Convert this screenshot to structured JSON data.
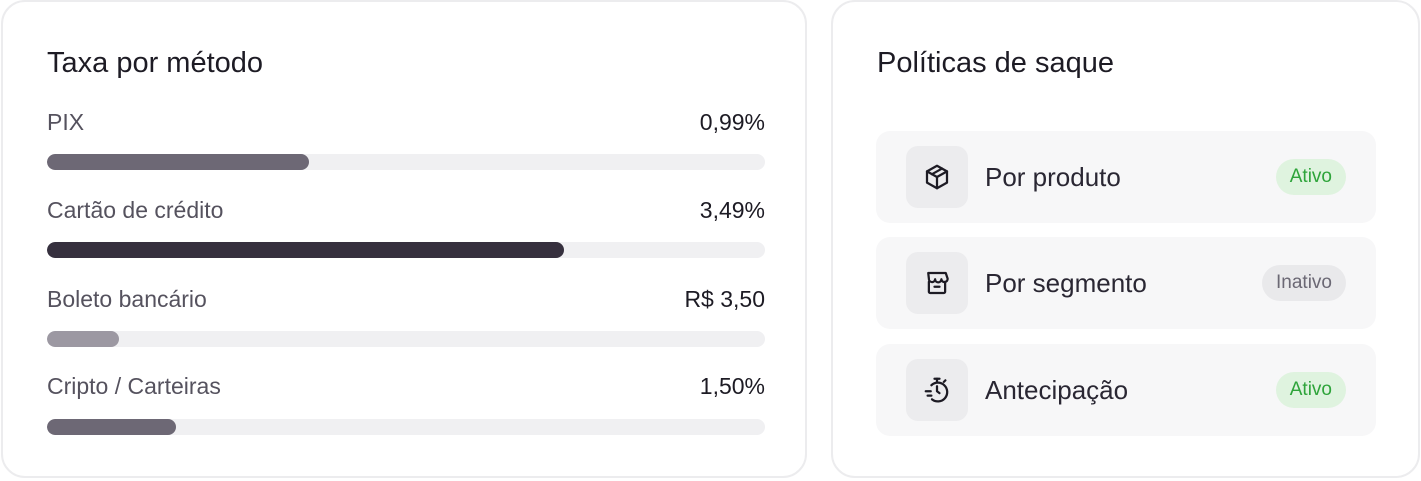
{
  "fees_card": {
    "title": "Taxa por método",
    "rows": [
      {
        "label": "PIX",
        "value": "0,99%",
        "level": 0.365,
        "color": "#6d6875"
      },
      {
        "label": "Cartão de crédito",
        "value": "3,49%",
        "level": 0.72,
        "color": "#36303e"
      },
      {
        "label": "Boleto bancário",
        "value": "R$ 3,50",
        "level": 0.1,
        "color": "#9c98a2"
      },
      {
        "label": "Cripto / Carteiras",
        "value": "1,50%",
        "level": 0.18,
        "color": "#6d6875"
      }
    ]
  },
  "policies_card": {
    "title": "Políticas de saque",
    "items": [
      {
        "label": "Por produto",
        "status": "Ativo",
        "icon": "package-icon"
      },
      {
        "label": "Por segmento",
        "status": "Inativo",
        "icon": "store-icon"
      },
      {
        "label": "Antecipação",
        "status": "Ativo",
        "icon": "fast-timer-icon"
      }
    ]
  }
}
